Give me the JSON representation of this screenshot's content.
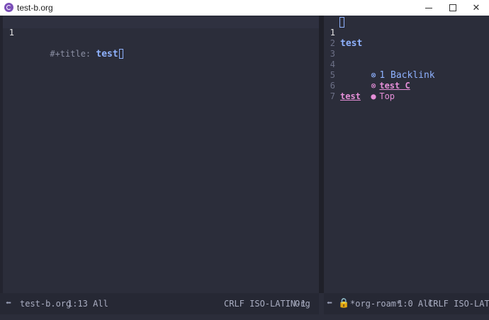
{
  "window": {
    "title": "test-b.org",
    "controls": {
      "minimize": "",
      "maximize": "",
      "close": "✕"
    }
  },
  "left_pane": {
    "lines": [
      {
        "num": "1",
        "keyword": "#+title: ",
        "value": "test"
      }
    ],
    "modeline": {
      "buffer": "test-b.org",
      "position": "1:13 All",
      "encoding": "CRLF ISO-LATIN-1",
      "mode": "Org"
    }
  },
  "right_pane": {
    "line_numbers": [
      "1",
      "2",
      "3",
      "4",
      "5",
      "6",
      "7"
    ],
    "title": "test",
    "backlink_header": "1 Backlink",
    "backlink_item": "test C",
    "top_item": "Top",
    "last_line": "test",
    "modeline": {
      "buffer": "*org-roam*",
      "position": "1:0 All",
      "encoding": "CRLF ISO-LATIN-"
    }
  }
}
